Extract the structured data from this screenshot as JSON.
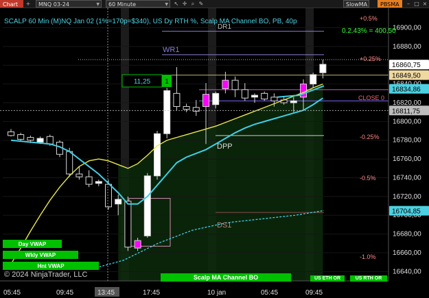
{
  "toolbar": {
    "chart_tab": "Chart",
    "instrument": "MNQ 03-24",
    "period": "60 Minute",
    "indicator_a": "SlowMA",
    "indicator_b": "PBSMA"
  },
  "header": {
    "title": "SCALP 60 Min (M)NQ Jan 02 (1%=170p=$340), US Dy RTH %, Scalp MA Channel BO, PB, 40p",
    "pct_readout": "0.2.43% = 400,50",
    "copyright": "© 2024 NinjaTrader, LLC"
  },
  "levels": {
    "dr1": "DR1",
    "wr1": "WR1",
    "dpp": "DPP",
    "ds1": "DS1",
    "close": "CLOSE 0",
    "p05": "+0.5%",
    "p025": "+0.25%",
    "m025": "-0.25%",
    "m05": "-0.5%",
    "m1": "-1.0%"
  },
  "flags": {
    "value": "11,25",
    "index": "1"
  },
  "badges": {
    "day_vwap": "Day VWAP",
    "wkly_vwap": "Wkly VWAP",
    "hnt_vwap": "Hnt VWAP",
    "scalp_bo": "Scalp MA Channel BO",
    "us_eth_or": "US ETH OR",
    "us_rth_or": "US RTH OR"
  },
  "price_axis": {
    "ticks": [
      "16900,00",
      "16880,00",
      "16860,00",
      "16840,00",
      "16820,00",
      "16800,00",
      "16780,00",
      "16760,00",
      "16740,00",
      "16720,00",
      "16700,00",
      "16680,00",
      "16660,00",
      "16640,00"
    ],
    "markers": [
      {
        "label": "16860,75",
        "price": 16860.75,
        "bg": "#ffffff",
        "fg": "#000000"
      },
      {
        "label": "16849,50",
        "price": 16849.5,
        "bg": "#f0d9a0",
        "fg": "#000000"
      },
      {
        "label": "16834,86",
        "price": 16834.86,
        "bg": "#4dd0e1",
        "fg": "#000000"
      },
      {
        "label": "16811,75",
        "price": 16811.75,
        "bg": "#bdbdbd",
        "fg": "#000000"
      },
      {
        "label": "16704,85",
        "price": 16704.85,
        "bg": "#4dd0e1",
        "fg": "#000000"
      }
    ]
  },
  "time_axis": {
    "labels": [
      "05:45",
      "09:45",
      "13:45",
      "17:45",
      "10 jan",
      "05:45",
      "09:45"
    ],
    "crosshair_label": "13:45"
  },
  "colors": {
    "up": "#ffffff",
    "down": "#000000",
    "highlight": "#ff00ff",
    "fast_ma": "#3fd0e6",
    "slow_ma": "#e8e84a",
    "pivot": "#8a7fd6",
    "green_badge": "#00c000"
  },
  "chart_data": {
    "type": "candlestick",
    "title": "SCALP 60 Min (M)NQ Jan 02",
    "ylim": [
      16630,
      16915
    ],
    "candles": [
      {
        "o": 16789,
        "h": 16792,
        "l": 16784,
        "c": 16785
      },
      {
        "o": 16786,
        "h": 16788,
        "l": 16779,
        "c": 16781
      },
      {
        "o": 16783,
        "h": 16785,
        "l": 16777,
        "c": 16780
      },
      {
        "o": 16778,
        "h": 16784,
        "l": 16776,
        "c": 16782
      },
      {
        "o": 16784,
        "h": 16786,
        "l": 16774,
        "c": 16776
      },
      {
        "o": 16778,
        "h": 16780,
        "l": 16762,
        "c": 16765
      },
      {
        "o": 16768,
        "h": 16772,
        "l": 16741,
        "c": 16744
      },
      {
        "o": 16744,
        "h": 16752,
        "l": 16738,
        "c": 16741
      },
      {
        "o": 16741,
        "h": 16748,
        "l": 16730,
        "c": 16733
      },
      {
        "o": 16734,
        "h": 16738,
        "l": 16731,
        "c": 16736
      },
      {
        "o": 16733,
        "h": 16738,
        "l": 16706,
        "c": 16709
      },
      {
        "o": 16712,
        "h": 16722,
        "l": 16700,
        "c": 16717
      },
      {
        "o": 16715,
        "h": 16720,
        "l": 16662,
        "c": 16666
      },
      {
        "o": 16665,
        "h": 16676,
        "l": 16662,
        "c": 16673
      },
      {
        "o": 16678,
        "h": 16745,
        "l": 16676,
        "c": 16742
      },
      {
        "o": 16742,
        "h": 16790,
        "l": 16738,
        "c": 16787
      },
      {
        "o": 16787,
        "h": 16836,
        "l": 16782,
        "c": 16833
      },
      {
        "o": 16830,
        "h": 16858,
        "l": 16812,
        "c": 16816
      },
      {
        "o": 16816,
        "h": 16819,
        "l": 16810,
        "c": 16813
      },
      {
        "o": 16815,
        "h": 16823,
        "l": 16806,
        "c": 16811
      },
      {
        "o": 16829,
        "h": 16841,
        "l": 16776,
        "c": 16816
      },
      {
        "o": 16818,
        "h": 16832,
        "l": 16814,
        "c": 16830
      },
      {
        "o": 16835,
        "h": 16853,
        "l": 16830,
        "c": 16844
      },
      {
        "o": 16844,
        "h": 16848,
        "l": 16826,
        "c": 16834
      },
      {
        "o": 16834,
        "h": 16841,
        "l": 16822,
        "c": 16825
      },
      {
        "o": 16826,
        "h": 16830,
        "l": 16820,
        "c": 16828
      },
      {
        "o": 16830,
        "h": 16832,
        "l": 16822,
        "c": 16824
      },
      {
        "o": 16826,
        "h": 16830,
        "l": 16816,
        "c": 16822
      },
      {
        "o": 16823,
        "h": 16827,
        "l": 16818,
        "c": 16820
      },
      {
        "o": 16820,
        "h": 16826,
        "l": 16810,
        "c": 16822
      },
      {
        "o": 16826,
        "h": 16845,
        "l": 16812,
        "c": 16840
      },
      {
        "o": 16840,
        "h": 16852,
        "l": 16836,
        "c": 16850
      },
      {
        "o": 16852,
        "h": 16866,
        "l": 16846,
        "c": 16861
      }
    ],
    "fast_ma": [
      16780,
      16779,
      16778,
      16777,
      16776,
      16773,
      16768,
      16760,
      16752,
      16744,
      16734,
      16724,
      16712,
      16712,
      16720,
      16732,
      16744,
      16756,
      16762,
      16766,
      16770,
      16776,
      16782,
      16788,
      16793,
      16797,
      16800,
      16803,
      16806,
      16809,
      16812,
      16818,
      16825
    ],
    "slow_ma": [
      16648,
      16665,
      16683,
      16700,
      16716,
      16730,
      16742,
      16752,
      16758,
      16760,
      16758,
      16754,
      16750,
      16755,
      16764,
      16774,
      16780,
      16783,
      16786,
      16789,
      16792,
      16795,
      16799,
      16803,
      16807,
      16811,
      16815,
      16819,
      16823,
      16827,
      16831,
      16836,
      16840
    ],
    "pivots": {
      "DR1": 16905,
      "WR1": 16880,
      "DPP": 16785,
      "DS1": 16703,
      "CLOSE": 16834
    }
  }
}
